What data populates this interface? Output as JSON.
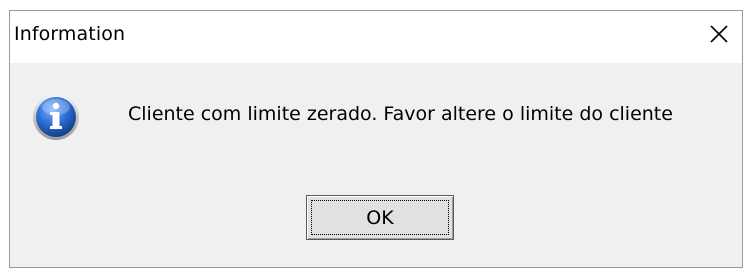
{
  "dialog": {
    "title": "Information",
    "close_icon": "close-icon",
    "icon": "information-icon",
    "message": "Cliente com limite zerado. Favor altere o limite do cliente",
    "ok_label": "OK"
  },
  "colors": {
    "titlebar_bg": "#ffffff",
    "dialog_bg": "#f0f0f0",
    "button_bg": "#e1e1e1",
    "icon_blue": "#1f5fc0"
  }
}
